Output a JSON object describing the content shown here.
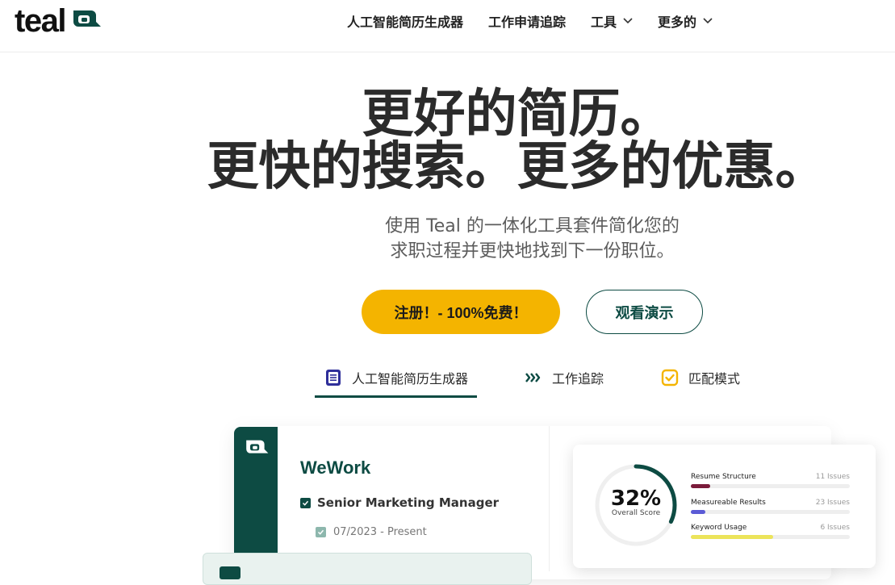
{
  "brand": {
    "name": "teal",
    "accent": "#0d4b43",
    "cta_color": "#f4b400"
  },
  "nav": {
    "items": [
      {
        "label": "人工智能简历生成器"
      },
      {
        "label": "工作申请追踪"
      },
      {
        "label": "工具",
        "icon": "chevron-down-icon"
      },
      {
        "label": "更多的",
        "icon": "chevron-down-icon"
      }
    ]
  },
  "hero": {
    "line1": "更好的简历。",
    "line2": "更快的搜索。更多的优惠。",
    "sub1": "使用 Teal 的一体化工具套件简化您的",
    "sub2": "求职过程并更快地找到下一份职位。",
    "cta_primary": "注册！- 100%免费！",
    "cta_secondary": "观看演示"
  },
  "tabs": [
    {
      "label": "人工智能简历生成器",
      "icon": "document-icon",
      "active": true
    },
    {
      "label": "工作追踪",
      "icon": "triple-chevron-icon",
      "active": false
    },
    {
      "label": "匹配模式",
      "icon": "checkbox-icon",
      "active": false
    }
  ],
  "resume": {
    "company": "WeWork",
    "role": "Senior Marketing Manager",
    "dates": "07/2023 - Present"
  },
  "score": {
    "value": "32%",
    "label": "Overall Score",
    "fraction": 0.32,
    "metrics": [
      {
        "name": "Resume Structure",
        "issues": "11 Issues",
        "fill": 0.12,
        "color": "#7a1b3a"
      },
      {
        "name": "Measureable Results",
        "issues": "23 Issues",
        "fill": 0.09,
        "color": "#5b5bd6"
      },
      {
        "name": "Keyword Usage",
        "issues": "6 Issues",
        "fill": 0.52,
        "color": "#ece45a"
      }
    ]
  }
}
